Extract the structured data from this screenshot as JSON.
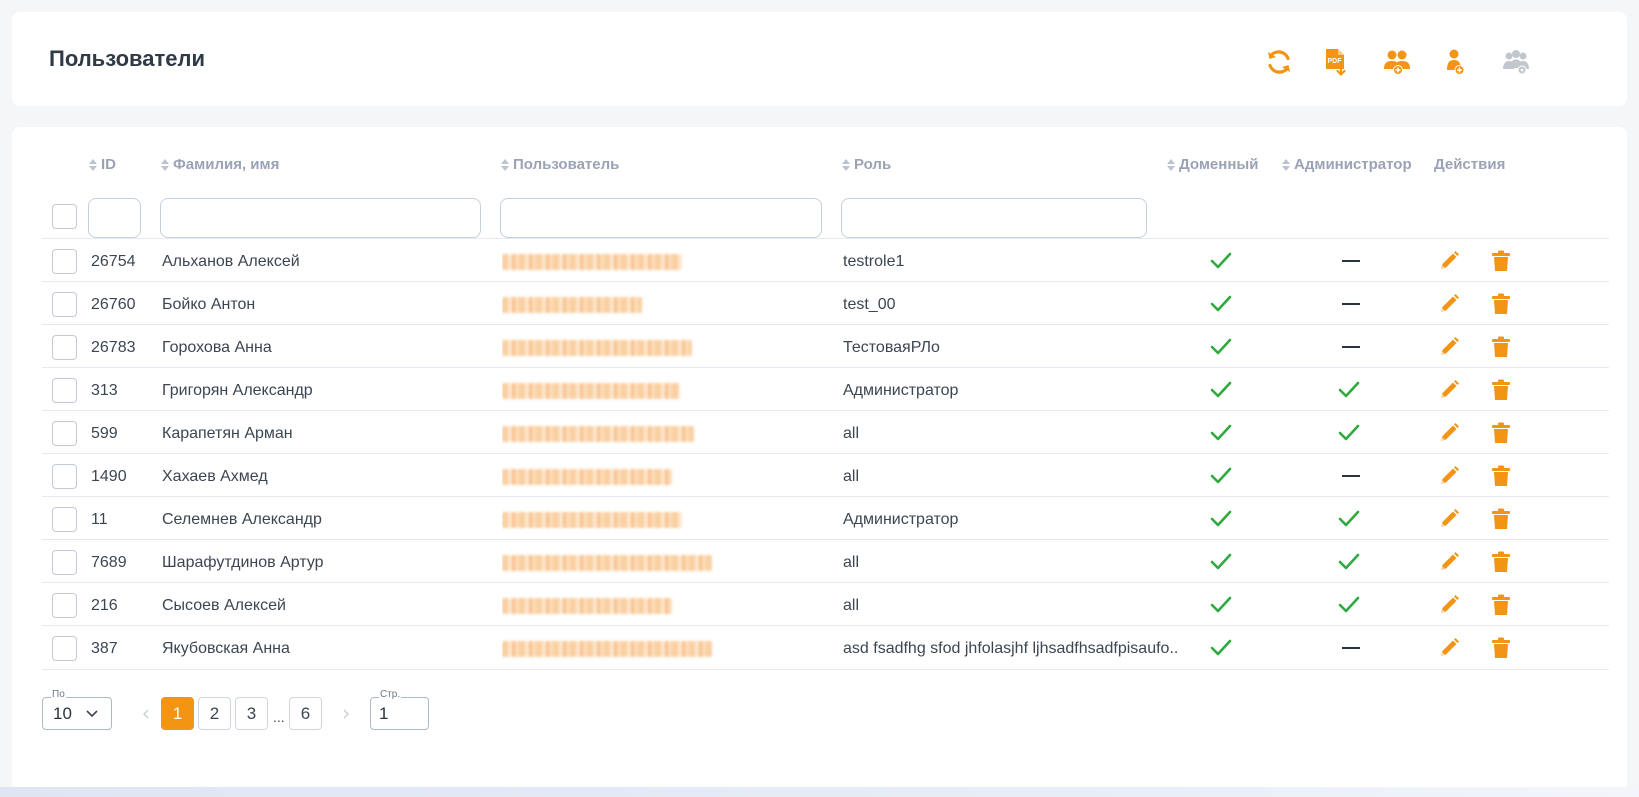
{
  "header": {
    "title": "Пользователи",
    "toolbar": [
      {
        "name": "refresh-icon",
        "state": "active"
      },
      {
        "name": "pdf-export-icon",
        "state": "active"
      },
      {
        "name": "add-group-icon",
        "state": "active"
      },
      {
        "name": "add-user-icon",
        "state": "active"
      },
      {
        "name": "group-settings-icon",
        "state": "disabled"
      }
    ]
  },
  "table": {
    "columns": {
      "id": "ID",
      "name": "Фамилия, имя",
      "user": "Пользователь",
      "role": "Роль",
      "domain": "Доменный",
      "admin": "Администратор",
      "actions": "Действия"
    },
    "filters": {
      "id": "",
      "name": "",
      "user": "",
      "role": ""
    },
    "rows": [
      {
        "id": "26754",
        "name": "Альханов Алексей",
        "role": "testrole1",
        "domain": true,
        "admin": false
      },
      {
        "id": "26760",
        "name": "Бойко Антон",
        "role": "test_00",
        "domain": true,
        "admin": false
      },
      {
        "id": "26783",
        "name": "Горохова Анна",
        "role": "ТестоваяРЛо",
        "domain": true,
        "admin": false
      },
      {
        "id": "313",
        "name": "Григорян Александр",
        "role": "Администратор",
        "domain": true,
        "admin": true
      },
      {
        "id": "599",
        "name": "Карапетян Арман",
        "role": "all",
        "domain": true,
        "admin": true
      },
      {
        "id": "1490",
        "name": "Хахаев Ахмед",
        "role": "all",
        "domain": true,
        "admin": false
      },
      {
        "id": "11",
        "name": "Селемнев Александр",
        "role": "Администратор",
        "domain": true,
        "admin": true
      },
      {
        "id": "7689",
        "name": "Шарафутдинов Артур",
        "role": "all",
        "domain": true,
        "admin": true
      },
      {
        "id": "216",
        "name": "Сысоев Алексей",
        "role": "all",
        "domain": true,
        "admin": true
      },
      {
        "id": "387",
        "name": "Якубовская Анна",
        "role": "asd fsadfhg sfod jhfolasjhf ljhsadfhsadfpisaufo...",
        "domain": true,
        "admin": false
      }
    ]
  },
  "pagination": {
    "per_page_label": "По",
    "per_page_value": "10",
    "pages": [
      "1",
      "2",
      "3",
      "6"
    ],
    "ellipsis": "...",
    "current_page": "1",
    "page_input_label": "Стр.",
    "page_input_value": "1"
  },
  "colors": {
    "accent": "#f39514",
    "check": "#2eaa3f",
    "disabled_icon": "#c2c7cf",
    "header_text": "#9aa3b5"
  }
}
